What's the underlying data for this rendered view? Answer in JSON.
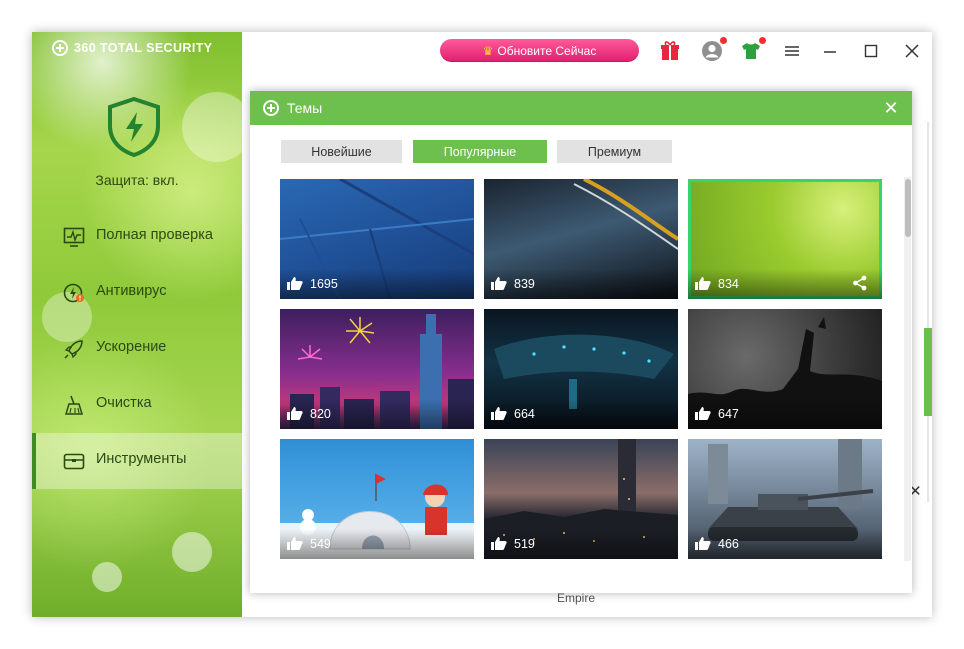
{
  "brand": {
    "name": "360 TOTAL SECURITY"
  },
  "protection": {
    "status": "Защита: вкл."
  },
  "nav": [
    {
      "label": "Полная проверка",
      "icon": "monitor-scan-icon"
    },
    {
      "label": "Антивирус",
      "icon": "antivirus-bolt-icon"
    },
    {
      "label": "Ускорение",
      "icon": "rocket-icon"
    },
    {
      "label": "Очистка",
      "icon": "broom-icon"
    },
    {
      "label": "Инструменты",
      "icon": "toolbox-icon",
      "active": true
    }
  ],
  "topbar": {
    "upgrade_label": "Обновите Сейчас",
    "icons": [
      "gift-icon",
      "avatar-icon",
      "theme-shirt-icon",
      "menu-icon",
      "minimize-icon",
      "maximize-icon",
      "close-icon"
    ]
  },
  "background_text": "Empire",
  "dialog": {
    "title": "Темы",
    "tabs": [
      {
        "label": "Новейшие",
        "active": false
      },
      {
        "label": "Популярные",
        "active": true
      },
      {
        "label": "Премиум",
        "active": false
      }
    ],
    "themes": [
      {
        "likes": "1695",
        "selected": false
      },
      {
        "likes": "839",
        "selected": false
      },
      {
        "likes": "834",
        "selected": true
      },
      {
        "likes": "820",
        "selected": false
      },
      {
        "likes": "664",
        "selected": false
      },
      {
        "likes": "647",
        "selected": false
      },
      {
        "likes": "549",
        "selected": false
      },
      {
        "likes": "519",
        "selected": false
      },
      {
        "likes": "466",
        "selected": false
      }
    ]
  },
  "colors": {
    "accent": "#6dc04d",
    "upgrade": "#e8297a",
    "selected_border": "#38d36a"
  }
}
